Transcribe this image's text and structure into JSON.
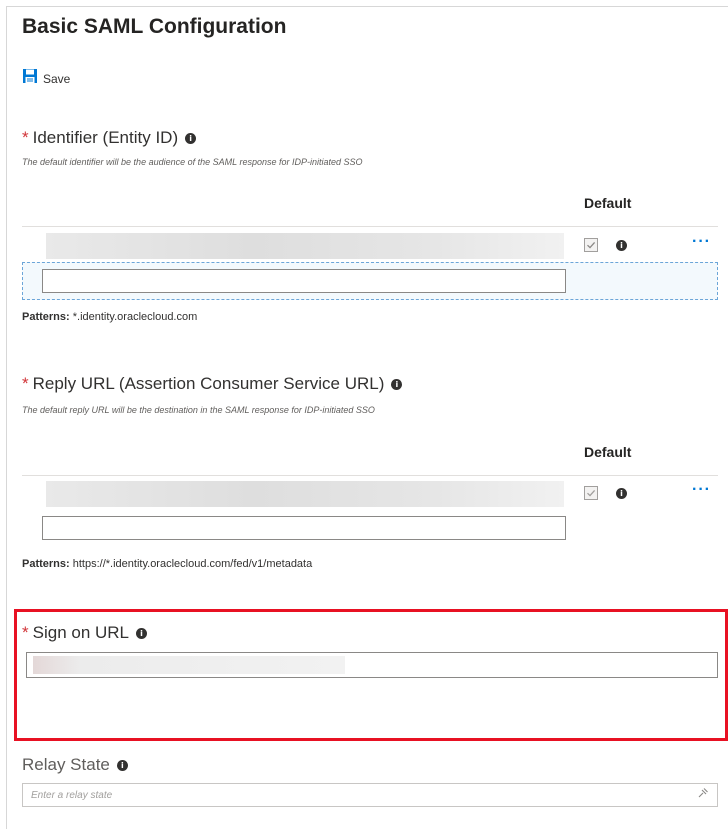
{
  "title": "Basic SAML Configuration",
  "toolbar": {
    "save_label": "Save"
  },
  "required_mark": "*",
  "info_glyph": "i",
  "identifier": {
    "label": "Identifier (Entity ID)",
    "description": "The default identifier will be the audience of the SAML response for IDP-initiated SSO",
    "default_header": "Default",
    "more_label": "···",
    "patterns_label": "Patterns:",
    "patterns_value": " *.identity.oraclecloud.com",
    "checked": true
  },
  "reply_url": {
    "label": "Reply URL (Assertion Consumer Service URL)",
    "description": "The default reply URL will be the destination in the SAML response for IDP-initiated SSO",
    "default_header": "Default",
    "more_label": "···",
    "patterns_label": "Patterns:",
    "patterns_value": " https://*.identity.oraclecloud.com/fed/v1/metadata",
    "checked": true
  },
  "sign_on": {
    "label": "Sign on URL"
  },
  "relay_state": {
    "label": "Relay State",
    "placeholder": "Enter a relay state"
  },
  "colors": {
    "accent": "#0078d4",
    "highlight": "#e81123",
    "required": "#d13438"
  }
}
